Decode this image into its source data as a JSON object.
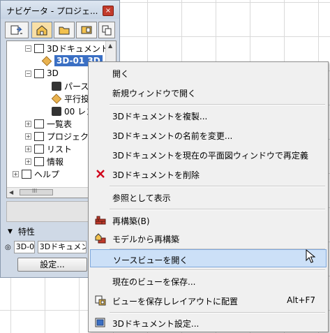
{
  "navigator": {
    "title": "ナビゲータ - プロジェ...",
    "close_glyph": "×",
    "tree": {
      "documents_folder": "3Dドキュメント",
      "selected_document": "3D-01 3D",
      "view_3d": "3D",
      "perspective": "パース",
      "parallel": "平行投",
      "list_item_00": "00 レン",
      "schedules": "一覧表",
      "project_index": "プロジェクト",
      "lists": "リスト",
      "info": "情報",
      "help": "ヘルプ"
    },
    "scroll_thumb_glyph": "III",
    "properties": {
      "header": "特性",
      "id_field": "3D-0",
      "type_field": "3Dドキュメント",
      "settings_button": "設定..."
    }
  },
  "context_menu": {
    "items": [
      {
        "label": "開く",
        "icon": ""
      },
      {
        "label": "新規ウィンドウで開く",
        "icon": ""
      },
      {
        "label": "3Dドキュメントを複製...",
        "icon": ""
      },
      {
        "label": "3Dドキュメントの名前を変更...",
        "icon": ""
      },
      {
        "label": "3Dドキュメントを現在の平面図ウィンドウで再定義",
        "icon": ""
      },
      {
        "label": "3Dドキュメントを削除",
        "icon": "delete-x-icon"
      },
      {
        "label": "参照として表示",
        "icon": ""
      },
      {
        "label": "再構築(B)",
        "icon": "rebuild-icon"
      },
      {
        "label": "モデルから再構築",
        "icon": "rebuild-from-model-icon"
      },
      {
        "label": "ソースビューを開く",
        "icon": ""
      },
      {
        "label": "現在のビューを保存...",
        "icon": ""
      },
      {
        "label": "ビューを保存しレイアウトに配置",
        "icon": "save-view-layout-icon",
        "shortcut": "Alt+F7"
      },
      {
        "label": "3Dドキュメント設定...",
        "icon": "document-settings-icon"
      }
    ],
    "highlighted_item": "ソースビューを開く"
  },
  "colors": {
    "menu_hover": "#cce0f7",
    "selection": "#3a6fc4",
    "delete_red": "#d0021b"
  }
}
